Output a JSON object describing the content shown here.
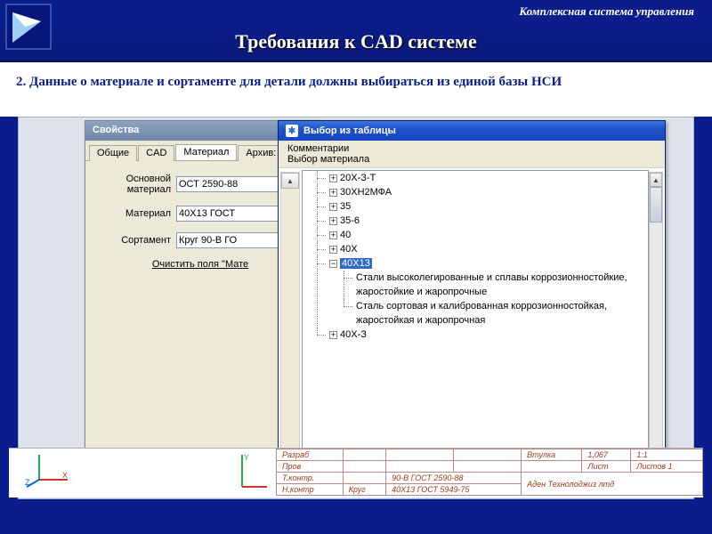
{
  "header": {
    "system_name": "Комплексная система управления",
    "title": "Требования к CAD системе"
  },
  "subtitle": "2. Данные о материале и сортаменте для детали должны выбираться из единой базы НСИ",
  "properties_window": {
    "title": "Свойства",
    "tabs": {
      "t1": "Общие",
      "t2": "CAD",
      "t3": "Материал",
      "t4": "Архив: $V"
    },
    "rows": {
      "main_material_label": "Основной материал",
      "main_material_value": "ОСТ 2590-88",
      "material_label": "Материал",
      "material_value": "40Х13 ГОСТ",
      "assortment_label": "Сортамент",
      "assortment_value": "Круг 90-В ГО"
    },
    "clear_link": "Очистить поля \"Мате"
  },
  "table_window": {
    "title": "Выбор из таблицы",
    "menu": {
      "m1": "Комментарии",
      "m2": "Выбор материала"
    },
    "tree": {
      "n1": "20Х-З-Т",
      "n2": "30ХН2МФА",
      "n3": "35",
      "n4": "35-6",
      "n5": "40",
      "n6": "40Х",
      "n7": "40Х13",
      "n7a": "Стали высоколегированные и сплавы коррозионностойкие, жаростойкие и жаропрочные",
      "n7b": "Сталь сортовая и калиброванная коррозионностойкая, жаростойкая и жаропрочная",
      "n8": "40Х-З"
    }
  },
  "bottom_table": {
    "r1": {
      "c1": "Разраб",
      "c5": "Втулка",
      "c6": "1,067",
      "c7": "1:1"
    },
    "r2": {
      "c1": "Пров",
      "c6": "Лист",
      "c7": "Листов 1"
    },
    "r3": {
      "c1": "Т.контр.",
      "c3": "90-В ГОСТ 2590-88"
    },
    "r4": {
      "c1": "Н.контр",
      "c2": "Круг",
      "c3": "40Х13 ГОСТ 5949-75",
      "c5": "Аден Технолоджиз лтд"
    }
  }
}
